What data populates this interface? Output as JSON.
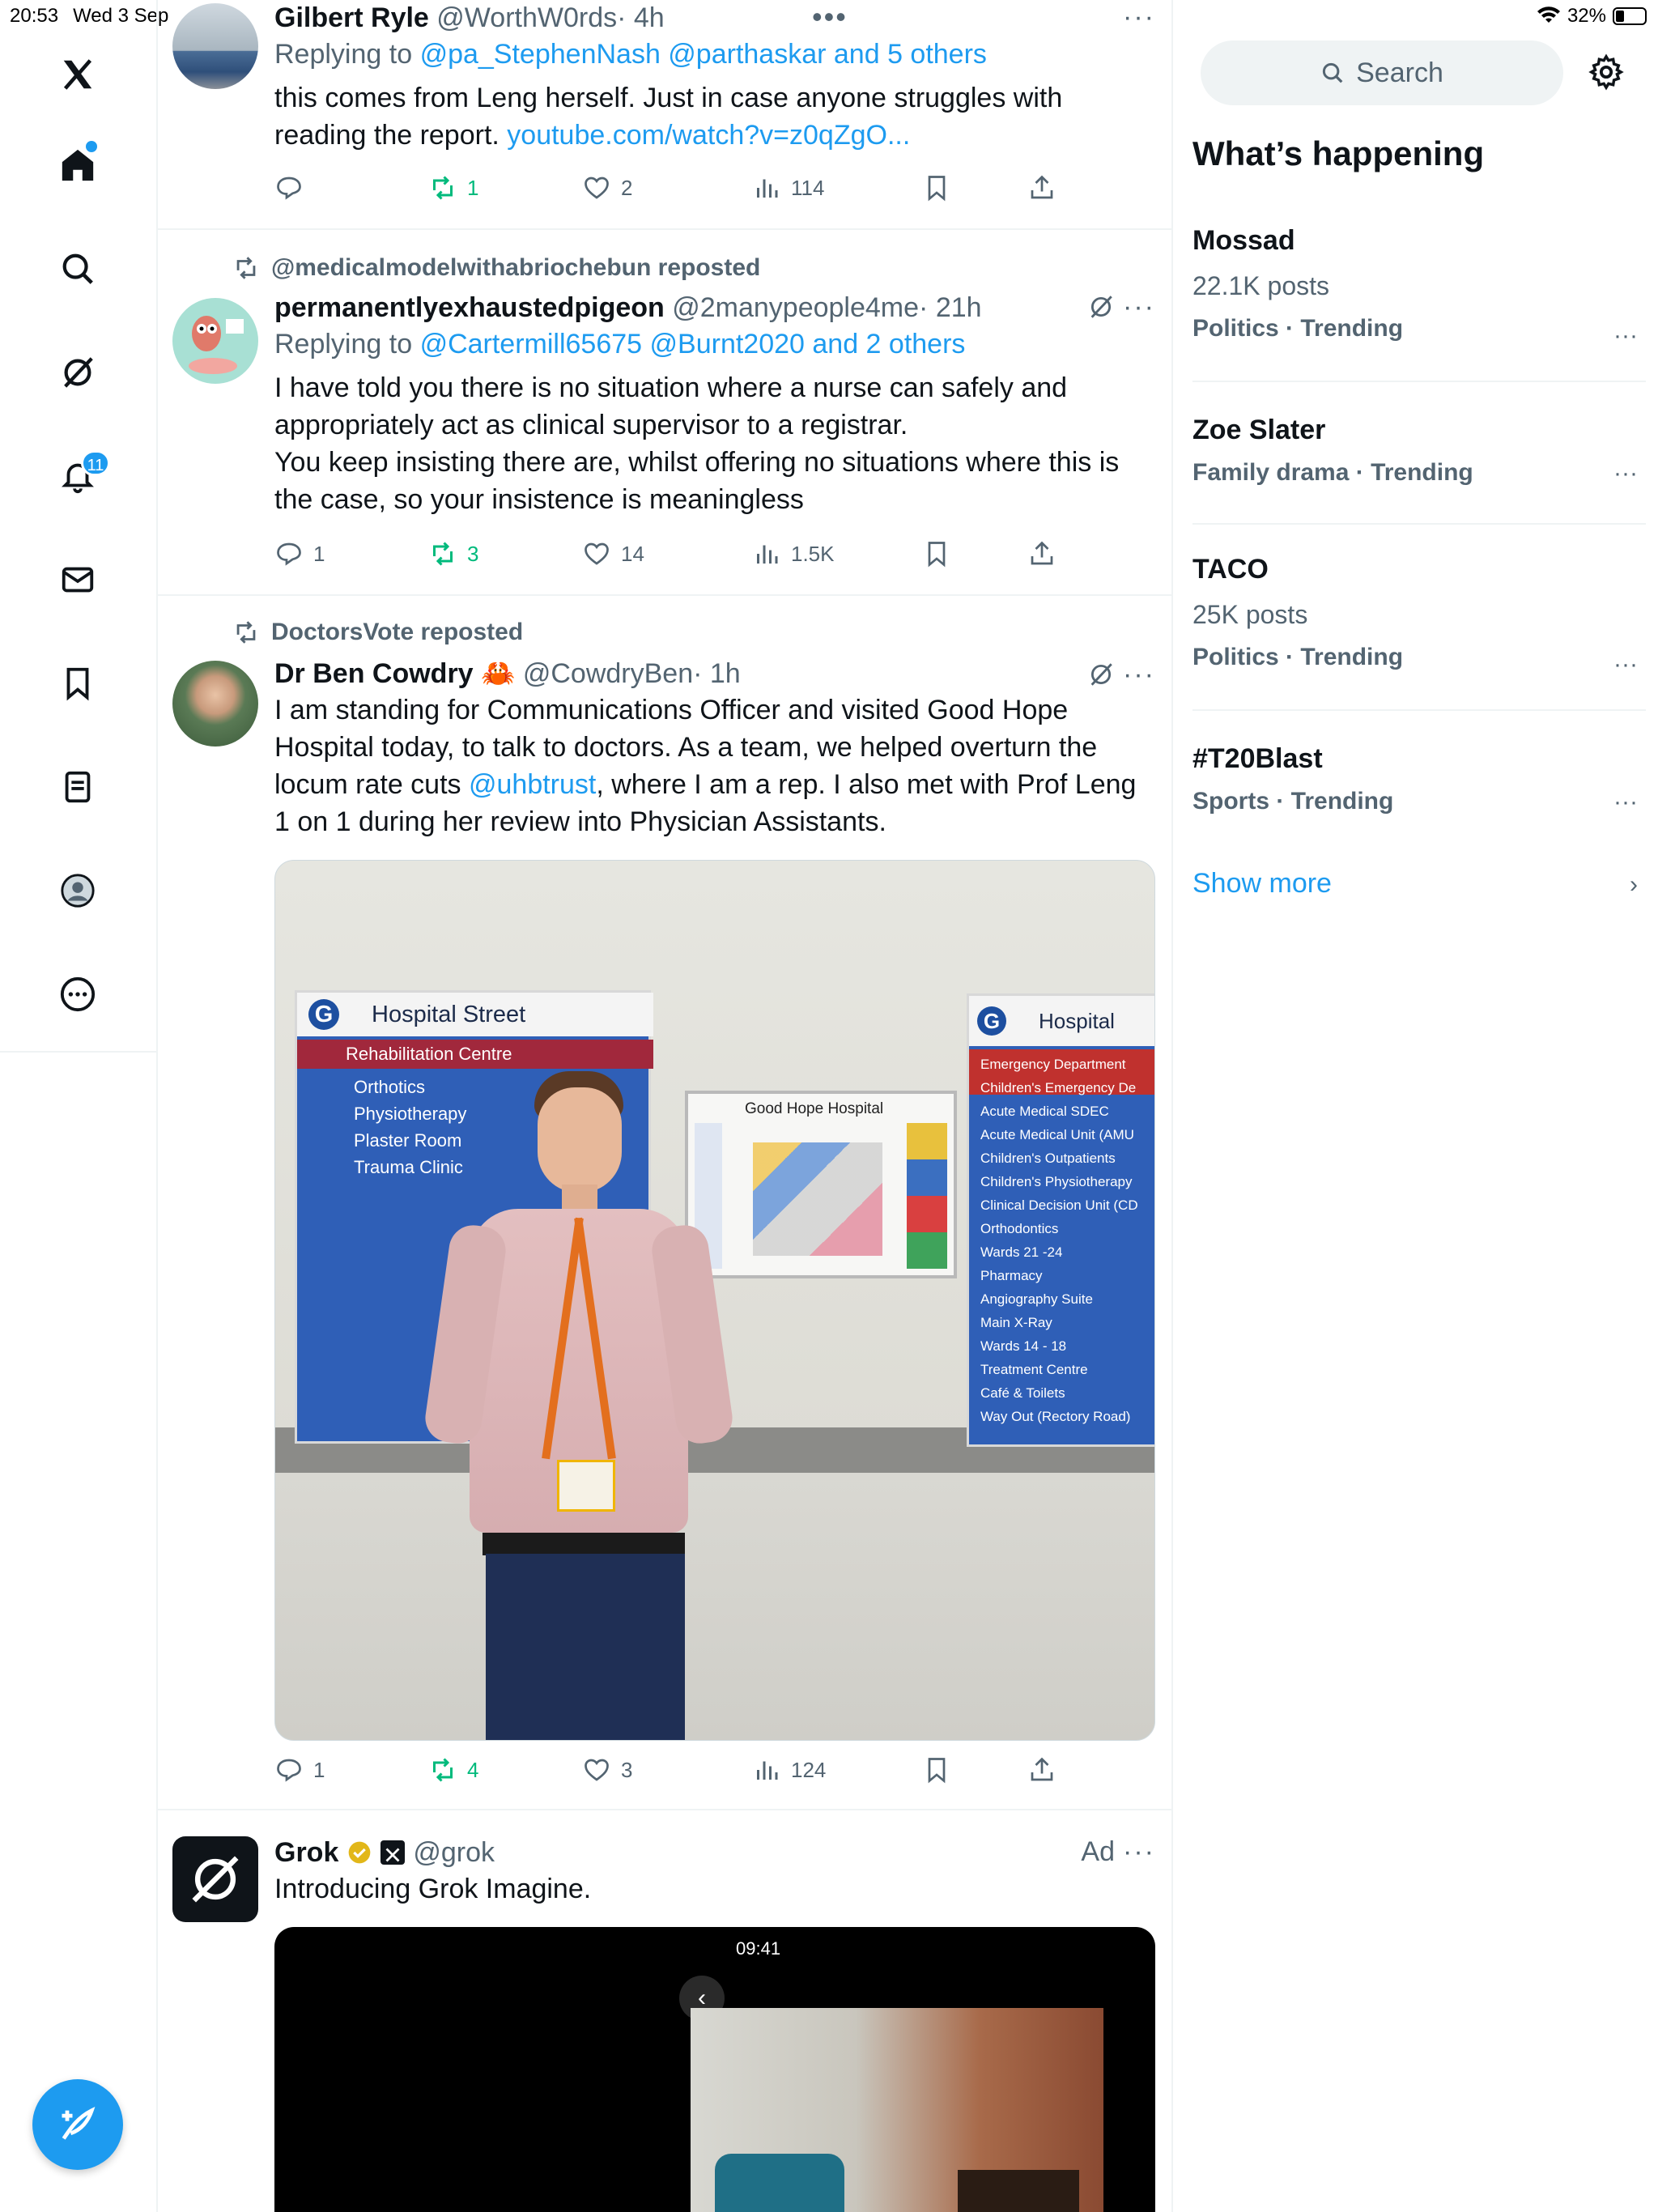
{
  "status": {
    "time": "20:53",
    "date": "Wed 3 Sep",
    "battery": "32%"
  },
  "nav": {
    "items": [
      "x-logo",
      "home",
      "explore",
      "grok",
      "notifications",
      "messages",
      "bookmarks",
      "lists",
      "profile",
      "more"
    ],
    "notifications_badge": "11"
  },
  "feed": {
    "tweet1": {
      "name": "Gilbert Ryle",
      "handle": "@WorthW0rds",
      "time": "· 4h",
      "reply_prefix": "Replying to",
      "reply_to": "@pa_StephenNash @parthaskar and 5 others",
      "text": "this comes from Leng herself. Just in case anyone struggles with reading the report.",
      "link": "youtube.com/watch?v=z0qZgO...",
      "retweets": "1",
      "likes": "2",
      "views": "114"
    },
    "tweet2": {
      "repost_by": "@medicalmodelwithabriochebun reposted",
      "name": "permanentlyexhaustedpigeon",
      "handle": "@2manypeople4me",
      "time": "· 21h",
      "reply_prefix": "Replying to",
      "reply_to": "@Cartermill65675 @Burnt2020 and 2 others",
      "text1": "I have told you there is no situation where a nurse can safely and appropriately act as clinical supervisor to a registrar.",
      "text2": "You keep insisting there are, whilst offering no situations where this is the case, so your insistence is meaningless",
      "replies": "1",
      "retweets": "3",
      "likes": "14",
      "views": "1.5K"
    },
    "tweet3": {
      "repost_by": "DoctorsVote reposted",
      "name": "Dr Ben Cowdry",
      "emoji": "🦀",
      "handle": "@CowdryBen",
      "time": "· 1h",
      "text_a": "I am standing for Communications Officer and visited Good Hope Hospital today, to talk to doctors. As a team, we helped overturn the locum rate cuts ",
      "mention": "@uhbtrust",
      "text_b": ", where I am a rep. I also met with Prof Leng 1 on 1 during her review into Physician Assistants.",
      "replies": "1",
      "retweets": "4",
      "likes": "3",
      "views": "124",
      "image": {
        "sign_left_title": "Hospital Street",
        "sign_left_badge": "G",
        "sign_left_items": [
          "Rehabilitation Centre",
          "Orthotics",
          "Physiotherapy",
          "Plaster Room",
          "Trauma Clinic"
        ],
        "map_title": "Good Hope Hospital",
        "sign_right_title": "Hospital",
        "sign_right_badge": "G",
        "sign_right_items": [
          "Emergency Department",
          "Children's Emergency De",
          "Acute Medical SDEC",
          "Acute Medical Unit (AMU",
          "Children's Outpatients",
          "Children's Physiotherapy",
          "Clinical Decision Unit (CD",
          "Orthodontics",
          "Wards 21 -24",
          "Pharmacy",
          "Angiography Suite",
          "Main X-Ray",
          "Wards 14 - 18",
          "Treatment Centre",
          "Café & Toilets",
          "Way Out (Rectory Road)"
        ]
      }
    },
    "tweet4": {
      "name": "Grok",
      "handle": "@grok",
      "ad_label": "Ad",
      "text": "Introducing Grok Imagine.",
      "video_time": "09:41"
    }
  },
  "sidebar": {
    "search_placeholder": "Search",
    "section_title": "What’s happening",
    "trends": [
      {
        "title": "Mossad",
        "posts": "22.1K posts",
        "category": "Politics · Trending"
      },
      {
        "title": "Zoe Slater",
        "posts": "",
        "category": "Family drama · Trending"
      },
      {
        "title": "TACO",
        "posts": "25K posts",
        "category": "Politics · Trending"
      },
      {
        "title": "#T20Blast",
        "posts": "",
        "category": "Sports · Trending"
      }
    ],
    "show_more": "Show more"
  },
  "colors": {
    "accent": "#1d9bf0",
    "repost_green": "#00ba7c",
    "muted": "#536471"
  }
}
